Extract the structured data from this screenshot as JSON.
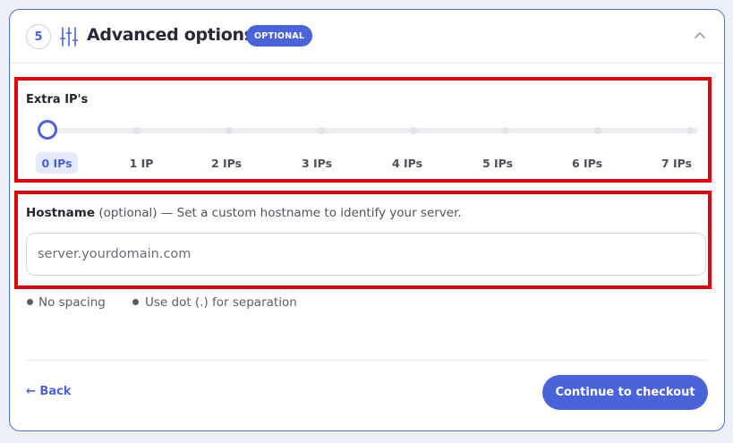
{
  "header": {
    "step_number": "5",
    "title": "Advanced options",
    "badge": "OPTIONAL",
    "icon": "sliders-icon",
    "toggle_icon": "chevron-up-icon"
  },
  "extra_ips": {
    "label": "Extra IP's",
    "selected_index": 0,
    "options": [
      "0 IPs",
      "1 IP",
      "2 IPs",
      "3 IPs",
      "4 IPs",
      "5 IPs",
      "6 IPs",
      "7 IPs"
    ]
  },
  "hostname": {
    "label": "Hostname",
    "optional_text": "(optional)",
    "help_text": "— Set a custom hostname to identify your server.",
    "placeholder": "server.yourdomain.com",
    "value": ""
  },
  "rules": [
    "No spacing",
    "Use dot (.) for separation"
  ],
  "footer": {
    "back_label": "← Back",
    "continue_label": "Continue to checkout"
  },
  "colors": {
    "accent": "#4a63d9",
    "highlight": "#e3000f",
    "page_background": "#eef0f8"
  }
}
